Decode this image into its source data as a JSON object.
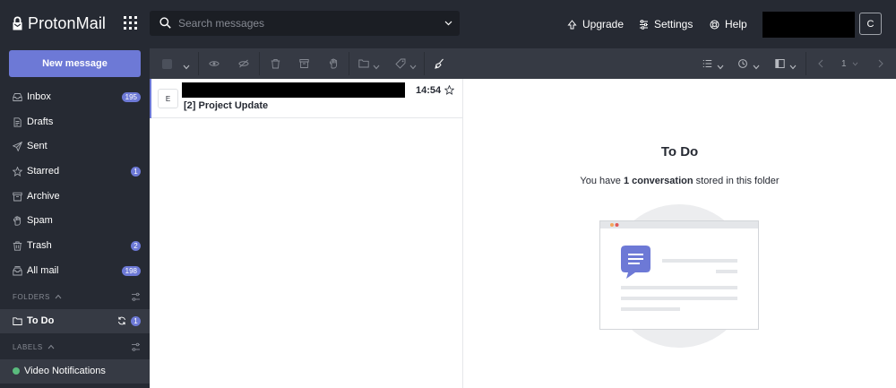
{
  "app": {
    "brand": "ProtonMail",
    "accent": "#6d79d6"
  },
  "header": {
    "search_placeholder": "Search messages",
    "upgrade_label": "Upgrade",
    "settings_label": "Settings",
    "help_label": "Help",
    "avatar_initial": "C"
  },
  "sidebar": {
    "compose_label": "New message",
    "items": [
      {
        "label": "Inbox",
        "icon": "inbox-icon",
        "badge": "195"
      },
      {
        "label": "Drafts",
        "icon": "drafts-icon"
      },
      {
        "label": "Sent",
        "icon": "sent-icon"
      },
      {
        "label": "Starred",
        "icon": "star-icon",
        "badge": "1"
      },
      {
        "label": "Archive",
        "icon": "archive-icon"
      },
      {
        "label": "Spam",
        "icon": "spam-icon"
      },
      {
        "label": "Trash",
        "icon": "trash-icon",
        "badge": "2"
      },
      {
        "label": "All mail",
        "icon": "all-mail-icon",
        "badge": "198"
      }
    ],
    "folders_heading": "FOLDERS",
    "folders": [
      {
        "label": "To Do",
        "badge": "1"
      }
    ],
    "labels_heading": "LABELS",
    "labels": [
      {
        "label": "Video Notifications",
        "color": "#5abb7d"
      }
    ]
  },
  "toolbar": {
    "page_number": "1"
  },
  "message_list": {
    "messages": [
      {
        "sender_initial": "E",
        "time": "14:54",
        "subject": "[2] Project Update"
      }
    ]
  },
  "reading_pane": {
    "title": "To Do",
    "desc_prefix": "You have ",
    "desc_count": "1 conversation",
    "desc_suffix": " stored in this folder"
  }
}
